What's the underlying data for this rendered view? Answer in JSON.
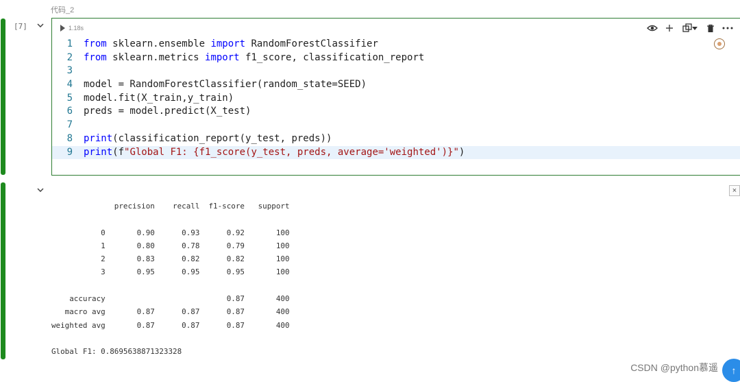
{
  "cell": {
    "title": "代码_2",
    "exec_count": "[7]",
    "run_time": "1.18s",
    "code_lines": [
      {
        "n": "1",
        "tokens": [
          {
            "t": "from",
            "c": "kw"
          },
          {
            "t": " sklearn.ensemble ",
            "c": "txt"
          },
          {
            "t": "import",
            "c": "kw"
          },
          {
            "t": " RandomForestClassifier",
            "c": "txt"
          }
        ]
      },
      {
        "n": "2",
        "tokens": [
          {
            "t": "from",
            "c": "kw"
          },
          {
            "t": " sklearn.metrics ",
            "c": "txt"
          },
          {
            "t": "import",
            "c": "kw"
          },
          {
            "t": " f1_score, classification_report",
            "c": "txt"
          }
        ]
      },
      {
        "n": "3",
        "tokens": []
      },
      {
        "n": "4",
        "tokens": [
          {
            "t": "model = RandomForestClassifier(random_state=SEED)",
            "c": "txt"
          }
        ]
      },
      {
        "n": "5",
        "tokens": [
          {
            "t": "model.fit(X_train,y_train)",
            "c": "txt"
          }
        ]
      },
      {
        "n": "6",
        "tokens": [
          {
            "t": "preds = model.predict(X_test)",
            "c": "txt"
          }
        ]
      },
      {
        "n": "7",
        "tokens": []
      },
      {
        "n": "8",
        "tokens": [
          {
            "t": "print",
            "c": "kw"
          },
          {
            "t": "(classification_report(y_test, preds))",
            "c": "txt"
          }
        ]
      },
      {
        "n": "9",
        "tokens": [
          {
            "t": "print",
            "c": "kw"
          },
          {
            "t": "(f",
            "c": "txt"
          },
          {
            "t": "\"Global F1: {f1_score(y_test, preds, average='weighted')}\"",
            "c": "str"
          },
          {
            "t": ")",
            "c": "txt"
          }
        ]
      }
    ]
  },
  "output": {
    "text": "              precision    recall  f1-score   support\n\n           0       0.90      0.93      0.92       100\n           1       0.80      0.78      0.79       100\n           2       0.83      0.82      0.82       100\n           3       0.95      0.95      0.95       100\n\n    accuracy                           0.87       400\n   macro avg       0.87      0.87      0.87       400\nweighted avg       0.87      0.87      0.87       400\n\nGlobal F1: 0.8695638871323328"
  },
  "watermark": "CSDN @python慕遥",
  "icons": [
    "eye-icon",
    "plus-icon",
    "copy-icon",
    "chevron-down-icon",
    "trash-icon",
    "more-icon",
    "badge-icon",
    "close-icon",
    "scroll-top-icon"
  ]
}
